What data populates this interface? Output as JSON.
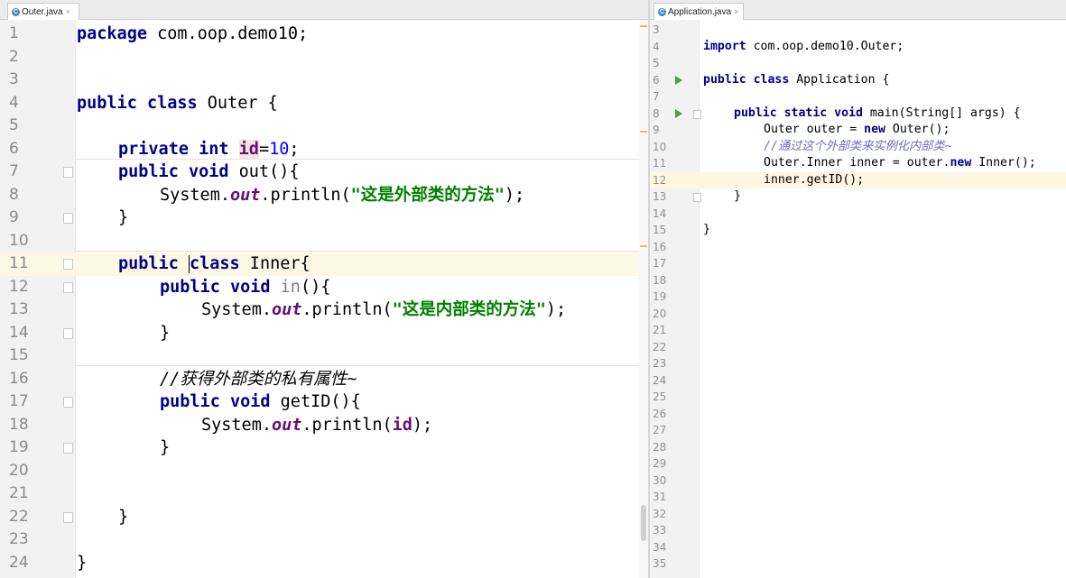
{
  "tabs": [
    {
      "label": "Outer.java",
      "icon": "java-class-icon",
      "close": "×"
    },
    {
      "label": "Application.java",
      "icon": "java-class-icon",
      "close": "×"
    }
  ],
  "outer_file": {
    "line_numbers": [
      "1",
      "2",
      "3",
      "4",
      "5",
      "6",
      "7",
      "8",
      "9",
      "10",
      "11",
      "12",
      "13",
      "14",
      "15",
      "16",
      "17",
      "18",
      "19",
      "20",
      "21",
      "22",
      "23",
      "24"
    ],
    "current_line": 11,
    "code": {
      "l1_kw": "package",
      "l1_rest": " com.oop.demo10;",
      "l4_kw": "public class",
      "l4_rest": " Outer {",
      "l6_kw": "private int",
      "l6_field": "id",
      "l6_eq": "=",
      "l6_num": "10",
      "l6_end": ";",
      "l7_kw": "public void",
      "l7_rest": " out(){",
      "l8_a": "System.",
      "l8_out": "out",
      "l8_b": ".println(",
      "l8_str": "\"这是外部类的方法\"",
      "l8_c": ");",
      "l9": "}",
      "l11_kw1": "public",
      "l11_kw2": "class",
      "l11_rest": " Inner{",
      "l12_kw": "public void",
      "l12_unused": "in",
      "l12_rest": "(){",
      "l13_a": "System.",
      "l13_out": "out",
      "l13_b": ".println(",
      "l13_str": "\"这是内部类的方法\"",
      "l13_c": ");",
      "l14": "}",
      "l16_cmt": "//获得外部类的私有属性~",
      "l17_kw": "public void",
      "l17_rest": " getID(){",
      "l18_a": "System.",
      "l18_out": "out",
      "l18_b": ".println(",
      "l18_fld": "id",
      "l18_c": ");",
      "l19": "}",
      "l22": "}",
      "l24": "}"
    }
  },
  "app_file": {
    "line_numbers": [
      "3",
      "4",
      "5",
      "6",
      "7",
      "8",
      "9",
      "10",
      "11",
      "12",
      "13",
      "14",
      "15",
      "16",
      "17",
      "18",
      "19",
      "20",
      "21",
      "22",
      "23",
      "24",
      "25",
      "26",
      "27",
      "28",
      "29",
      "30",
      "31",
      "32",
      "33",
      "34",
      "35"
    ],
    "current_line": 12,
    "code": {
      "l4_kw": "import",
      "l4_rest": " com.oop.demo10.Outer;",
      "l6_kw": "public class",
      "l6_rest": " Application {",
      "l8_kw": "public static void",
      "l8_rest": " main(String[] args) {",
      "l9_a": "Outer outer = ",
      "l9_kw": "new",
      "l9_b": " Outer();",
      "l10_cmt": "//通过这个外部类来实例化内部类~",
      "l11_a": "Outer.Inner inner = outer.",
      "l11_kw": "new",
      "l11_b": " Inner();",
      "l12": "inner.getID();",
      "l13": "}",
      "l15": "}"
    }
  },
  "colors": {
    "keyword": "#00008a",
    "field": "#660e7a",
    "number": "#0000ff",
    "string": "#008000",
    "comment": "#6d6dc7",
    "current_line": "#fdf8e3",
    "run_icon": "#4a9d4a"
  }
}
